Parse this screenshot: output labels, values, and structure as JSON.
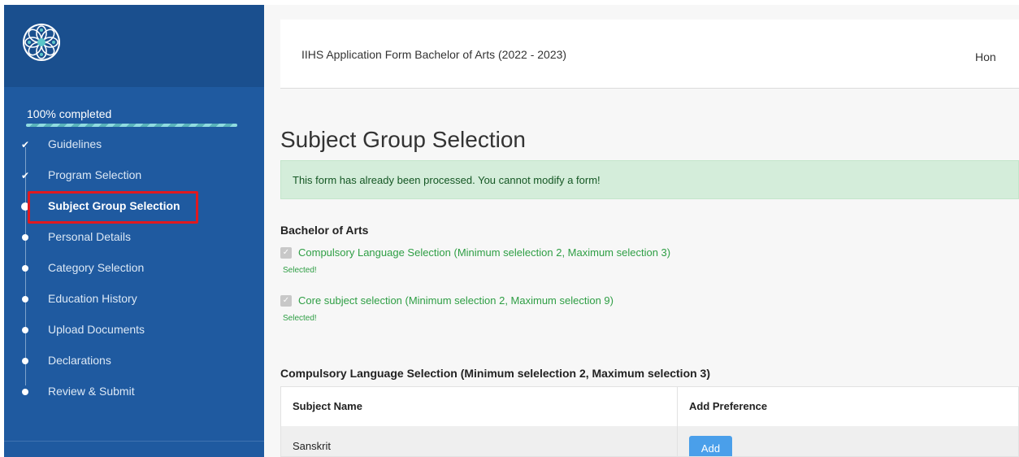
{
  "colors": {
    "sidebar": "#1f5aa0",
    "sidebar_header": "#1a4f8e",
    "accent_button": "#4a9fea",
    "success_text": "#2e9e44",
    "alert_bg": "#d4edda",
    "highlight": "#e0191f"
  },
  "sidebar": {
    "logo": "floral-logo-icon",
    "progress": {
      "label": "100% completed",
      "value": 1.0
    },
    "steps": [
      {
        "label": "Guidelines",
        "status": "done",
        "icon": "check-icon"
      },
      {
        "label": "Program Selection",
        "status": "done",
        "icon": "check-icon"
      },
      {
        "label": "Subject Group Selection",
        "status": "current",
        "icon": "dot-icon"
      },
      {
        "label": "Personal Details",
        "status": "pending",
        "icon": "dot-icon"
      },
      {
        "label": "Category Selection",
        "status": "pending",
        "icon": "dot-icon"
      },
      {
        "label": "Education History",
        "status": "pending",
        "icon": "dot-icon"
      },
      {
        "label": "Upload Documents",
        "status": "pending",
        "icon": "dot-icon"
      },
      {
        "label": "Declarations",
        "status": "pending",
        "icon": "dot-icon"
      },
      {
        "label": "Review & Submit",
        "status": "pending",
        "icon": "dot-icon"
      }
    ]
  },
  "header": {
    "title": "IIHS Application Form Bachelor of Arts (2022 - 2023)",
    "home_link": "Hon"
  },
  "main": {
    "page_title": "Subject Group Selection",
    "alert": "This form has already been processed. You cannot modify a form!",
    "program_title": "Bachelor of Arts",
    "groups": [
      {
        "label": "Compulsory Language Selection (Minimum selelection 2, Maximum selection 3)",
        "status": "Selected!",
        "checked": true
      },
      {
        "label": "Core subject selection (Minimum selection 2, Maximum selection 9)",
        "status": "Selected!",
        "checked": true
      }
    ],
    "table_section_title": "Compulsory Language Selection (Minimum selelection 2, Maximum selection 3)",
    "table": {
      "headers": [
        "Subject Name",
        "Add Preference"
      ],
      "rows": [
        {
          "subject": "Sanskrit",
          "action": "Add"
        }
      ]
    }
  }
}
